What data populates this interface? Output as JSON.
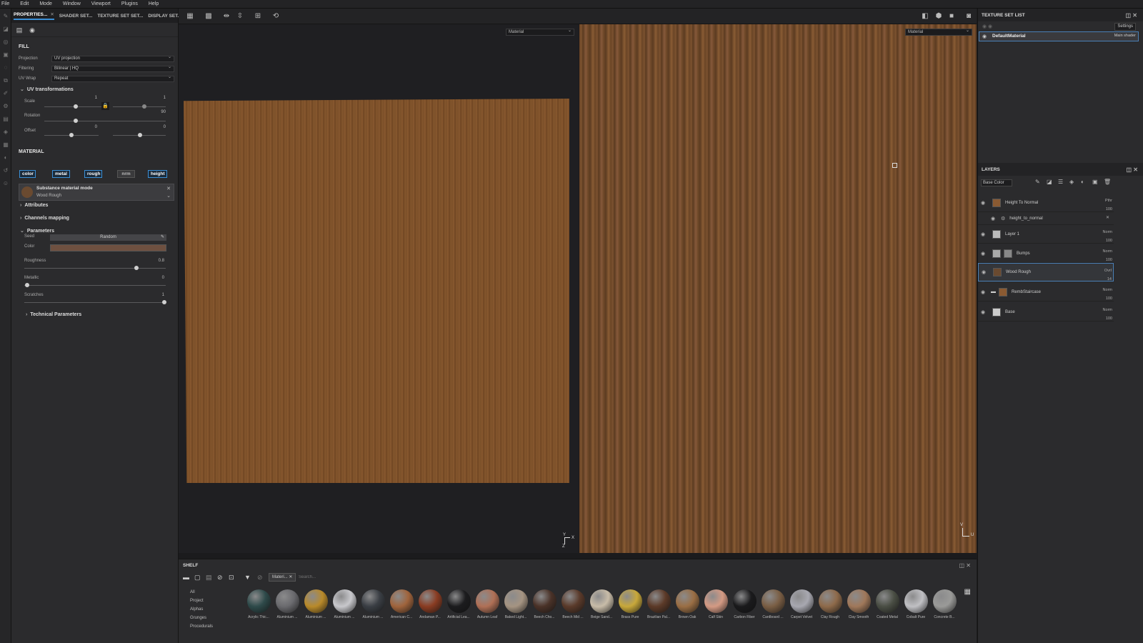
{
  "menu": [
    "File",
    "Edit",
    "Mode",
    "Window",
    "Viewport",
    "Plugins",
    "Help"
  ],
  "left_panel": {
    "tabs": [
      {
        "label": "PROPERTIES...",
        "active": true,
        "close": "✕"
      },
      {
        "label": "SHADER SET...",
        "active": false
      },
      {
        "label": "TEXTURE SET SET...",
        "active": false
      },
      {
        "label": "DISPLAY SET...",
        "active": false
      }
    ],
    "fill": {
      "title": "FILL",
      "projection_label": "Projection",
      "projection_value": "UV projection",
      "filtering_label": "Filtering",
      "filtering_value": "Bilinear | HQ",
      "uvwrap_label": "UV Wrap",
      "uvwrap_value": "Repeat"
    },
    "uv_transform": {
      "title": "UV transformations",
      "scale_label": "Scale",
      "scale_value": "1",
      "scale_value2": "1",
      "rotation_label": "Rotation",
      "rotation_value": "90",
      "offset_label": "Offset",
      "offset_value": "0",
      "offset_value2": "0"
    },
    "material": {
      "title": "MATERIAL",
      "channels": [
        {
          "label": "color",
          "active": true
        },
        {
          "label": "metal",
          "active": true
        },
        {
          "label": "rough",
          "active": true
        },
        {
          "label": "nrm",
          "active": false
        },
        {
          "label": "height",
          "active": true
        }
      ],
      "mode_title": "Substance material mode",
      "mode_value": "Wood Rough"
    },
    "attributes": "Attributes",
    "channels_mapping": "Channels mapping",
    "parameters": {
      "title": "Parameters",
      "seed_label": "Seed",
      "seed_value": "Random",
      "color_label": "Color",
      "color_swatch": "#6e5040",
      "roughness_label": "Roughness",
      "roughness_value": "0.8",
      "metallic_label": "Metallic",
      "metallic_value": "0",
      "scratches_label": "Scratches",
      "scratches_value": "1"
    },
    "technical": "Technical Parameters"
  },
  "viewport": {
    "left_select": "Material",
    "right_select": "Material",
    "axis_left": {
      "y": "Y",
      "x": "X",
      "z": "Z"
    },
    "axis_right": {
      "v": "V",
      "u": "U"
    }
  },
  "texture_set_list": {
    "title": "TEXTURE SET LIST",
    "settings": "Settings",
    "material": "DefaultMaterial",
    "shader": "Main shader"
  },
  "layers": {
    "title": "LAYERS",
    "channel": "Base Color",
    "items": [
      {
        "name": "Height To Normal",
        "blend": "Pthr",
        "opacity": "100",
        "thumb": "#8a5a32"
      },
      {
        "name": "height_to_normal",
        "blend": "",
        "opacity": "",
        "thumb": "#444"
      },
      {
        "name": "Layer 1",
        "blend": "Norm",
        "opacity": "100",
        "thumb": "#bbb"
      },
      {
        "name": "Bumps",
        "blend": "Norm",
        "opacity": "100",
        "thumb": "#aaa"
      },
      {
        "name": "Wood Rough",
        "blend": "Ovrl",
        "opacity": "14",
        "thumb": "#6a4a30"
      },
      {
        "name": "RembStaircase",
        "blend": "Norm",
        "opacity": "100",
        "thumb": "#8a5a32"
      },
      {
        "name": "Base",
        "blend": "Norm",
        "opacity": "100",
        "thumb": "#ccc"
      }
    ]
  },
  "shelf": {
    "title": "SHELF",
    "filter_tag": "Materi...",
    "search_placeholder": "Search...",
    "nav": [
      "All",
      "Project",
      "Alphas",
      "Grunges",
      "Procedurals"
    ],
    "materials": [
      {
        "name": "Acrylic Thic...",
        "color": "#2e4a4a"
      },
      {
        "name": "Aluminium ...",
        "color": "#6a6a6e"
      },
      {
        "name": "Aluminium ...",
        "color": "#b98a2a"
      },
      {
        "name": "Aluminium ...",
        "color": "#c8c8cc"
      },
      {
        "name": "Aluminium ...",
        "color": "#3a3e44"
      },
      {
        "name": "American C...",
        "color": "#a0643c"
      },
      {
        "name": "Andaman P...",
        "color": "#8a3c22"
      },
      {
        "name": "Artificial Lea...",
        "color": "#1c1c1e"
      },
      {
        "name": "Autumn Leaf",
        "color": "#b07056"
      },
      {
        "name": "Baked Light...",
        "color": "#a59482"
      },
      {
        "name": "Beech Cho...",
        "color": "#4a3228"
      },
      {
        "name": "Beech Mid ...",
        "color": "#5a3a2a"
      },
      {
        "name": "Beige Sand...",
        "color": "#c8bca8"
      },
      {
        "name": "Brass Pure",
        "color": "#c8a83a"
      },
      {
        "name": "Brazilian Pal...",
        "color": "#5c3a28"
      },
      {
        "name": "Brown Oak",
        "color": "#9a6e44"
      },
      {
        "name": "Calf Skin",
        "color": "#d49a84"
      },
      {
        "name": "Carbon Fiber",
        "color": "#1a1a1c"
      },
      {
        "name": "Cardboard ...",
        "color": "#7a5e44"
      },
      {
        "name": "Carpet Velvet",
        "color": "#a8a8b0"
      },
      {
        "name": "Clay Rough",
        "color": "#8e6a4a"
      },
      {
        "name": "Clay Smooth",
        "color": "#a0785a"
      },
      {
        "name": "Coated Metal",
        "color": "#4a4e44"
      },
      {
        "name": "Cobalt Pure",
        "color": "#c0c0c4"
      },
      {
        "name": "Concrete B...",
        "color": "#9a9a98"
      }
    ]
  }
}
